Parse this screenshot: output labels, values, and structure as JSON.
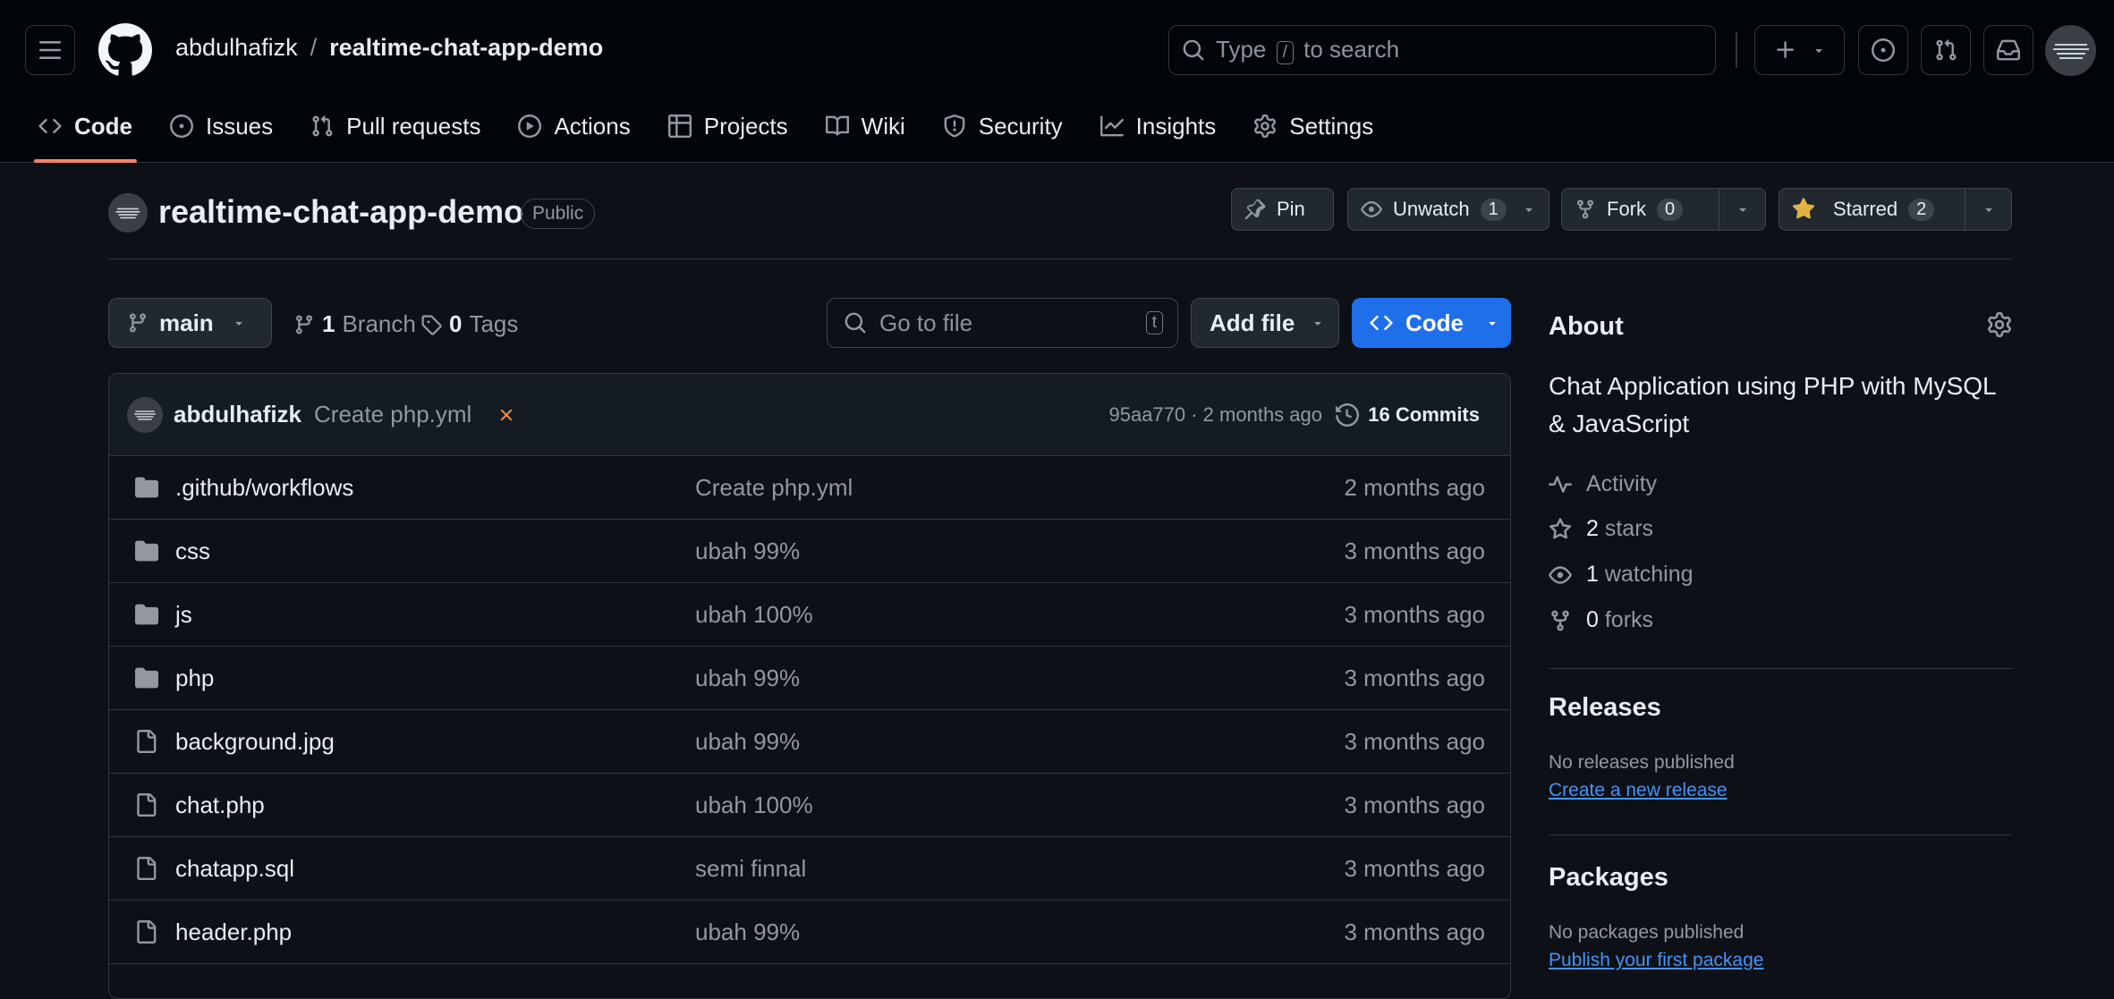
{
  "header": {
    "owner": "abdulhafizk",
    "separator": "/",
    "repo": "realtime-chat-app-demo",
    "search_before": "Type",
    "search_key": "/",
    "search_after": "to search"
  },
  "nav_tabs": [
    {
      "label": "Code",
      "icon": "code-icon",
      "active": true
    },
    {
      "label": "Issues",
      "icon": "issue-opened-icon"
    },
    {
      "label": "Pull requests",
      "icon": "git-pull-request-icon"
    },
    {
      "label": "Actions",
      "icon": "play-icon"
    },
    {
      "label": "Projects",
      "icon": "table-icon"
    },
    {
      "label": "Wiki",
      "icon": "book-icon"
    },
    {
      "label": "Security",
      "icon": "shield-icon"
    },
    {
      "label": "Insights",
      "icon": "graph-icon"
    },
    {
      "label": "Settings",
      "icon": "gear-icon"
    }
  ],
  "repo_head": {
    "title": "realtime-chat-app-demo",
    "visibility": "Public",
    "pin_label": "Pin",
    "watch_label": "Unwatch",
    "watch_count": "1",
    "fork_label": "Fork",
    "fork_count": "0",
    "star_label": "Starred",
    "star_count": "2"
  },
  "toolbar": {
    "branch": "main",
    "branch_count": "1",
    "branch_label": "Branch",
    "tag_count": "0",
    "tag_label": "Tags",
    "goto_placeholder": "Go to file",
    "goto_key": "t",
    "add_file": "Add file",
    "code_label": "Code"
  },
  "latest_commit": {
    "author": "abdulhafizk",
    "message": "Create php.yml",
    "status": "failed",
    "hash_time": "95aa770 · 2 months ago",
    "commits_label": "16 Commits"
  },
  "files": [
    {
      "name": ".github/workflows",
      "type": "folder",
      "message": "Create php.yml",
      "date": "2 months ago"
    },
    {
      "name": "css",
      "type": "folder",
      "message": "ubah 99%",
      "date": "3 months ago"
    },
    {
      "name": "js",
      "type": "folder",
      "message": "ubah 100%",
      "date": "3 months ago"
    },
    {
      "name": "php",
      "type": "folder",
      "message": "ubah 99%",
      "date": "3 months ago"
    },
    {
      "name": "background.jpg",
      "type": "file",
      "message": "ubah 99%",
      "date": "3 months ago"
    },
    {
      "name": "chat.php",
      "type": "file",
      "message": "ubah 100%",
      "date": "3 months ago"
    },
    {
      "name": "chatapp.sql",
      "type": "file",
      "message": "semi finnal",
      "date": "3 months ago"
    },
    {
      "name": "header.php",
      "type": "file",
      "message": "ubah 99%",
      "date": "3 months ago"
    }
  ],
  "about": {
    "heading": "About",
    "description": "Chat Application using PHP with MySQL & JavaScript",
    "activity": "Activity",
    "stars_count": "2",
    "stars_label": "stars",
    "watching_count": "1",
    "watching_label": "watching",
    "forks_count": "0",
    "forks_label": "forks"
  },
  "releases": {
    "heading": "Releases",
    "note": "No releases published",
    "link": "Create a new release"
  },
  "packages": {
    "heading": "Packages",
    "note": "No packages published",
    "link": "Publish your first package"
  },
  "colors": {
    "background": "#0d1117",
    "header": "#010409",
    "accent_tab": "#f78166",
    "primary_button": "#1f6feb",
    "link": "#4493f8",
    "error": "#f0883e",
    "star": "#e3b341"
  }
}
